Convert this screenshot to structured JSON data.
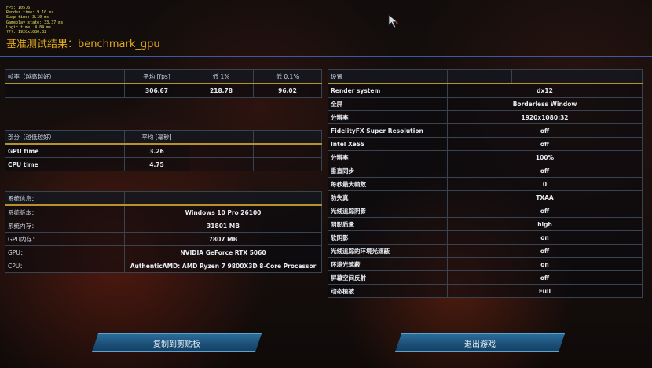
{
  "overlay_stats": [
    "FPS: 105.6",
    "Render time: 9.10 ms",
    "Swap time: 3.10 ms",
    "Gameplay state: 33.37 ms",
    "Logic time: 4.84 ms",
    "???: 1920x1080:32"
  ],
  "title": "基准测试结果：benchmark_gpu",
  "fps_table": {
    "headers": [
      "帧率（越高越好）",
      "平均 [fps]",
      "低 1%",
      "低 0.1%"
    ],
    "row": [
      "",
      "306.67",
      "218.78",
      "96.02"
    ]
  },
  "parts_table": {
    "headers": [
      "部分（越低越好）",
      "平均 [毫秒]",
      "",
      ""
    ],
    "rows": [
      {
        "label": "GPU time",
        "value": "3.26"
      },
      {
        "label": "CPU time",
        "value": "4.75"
      }
    ]
  },
  "sysinfo_table": {
    "header": "系统信息：",
    "rows": [
      {
        "label": "系统版本：",
        "value": "Windows 10 Pro 26100"
      },
      {
        "label": "系统内存：",
        "value": "31801 MB"
      },
      {
        "label": "GPU内存：",
        "value": "7807 MB"
      },
      {
        "label": "GPU：",
        "value": "NVIDIA GeForce RTX 5060"
      },
      {
        "label": "CPU：",
        "value": "AuthenticAMD: AMD Ryzen 7 9800X3D 8-Core Processor"
      }
    ]
  },
  "settings_table": {
    "header": "设置",
    "rows": [
      {
        "label": "Render system",
        "value": "dx12"
      },
      {
        "label": "全屏",
        "value": "Borderless Window"
      },
      {
        "label": "分辨率",
        "value": "1920x1080:32"
      },
      {
        "label": "FidelityFX Super Resolution",
        "value": "off"
      },
      {
        "label": "Intel XeSS",
        "value": "off"
      },
      {
        "label": "分辨率",
        "value": "100%"
      },
      {
        "label": "垂直同步",
        "value": "off"
      },
      {
        "label": "每秒最大帧数",
        "value": "0"
      },
      {
        "label": "防失真",
        "value": "TXAA"
      },
      {
        "label": "光线追踪阴影",
        "value": "off"
      },
      {
        "label": "阴影质量",
        "value": "high"
      },
      {
        "label": "软阴影",
        "value": "on"
      },
      {
        "label": "光线追踪的环境光遮蔽",
        "value": "off"
      },
      {
        "label": "环境光遮蔽",
        "value": "on"
      },
      {
        "label": "屏幕空间反射",
        "value": "off"
      },
      {
        "label": "动态植被",
        "value": "Full"
      }
    ]
  },
  "buttons": {
    "copy": "复制到剪贴板",
    "exit": "退出游戏"
  }
}
